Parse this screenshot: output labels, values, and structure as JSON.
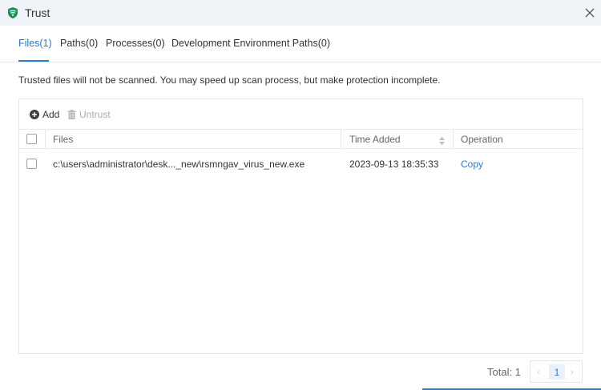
{
  "window": {
    "title": "Trust",
    "icon": "shield-icon",
    "close_icon": "close-icon"
  },
  "tabs": [
    {
      "label": "Files(1)",
      "active": true
    },
    {
      "label": "Paths(0)",
      "active": false
    },
    {
      "label": "Processes(0)",
      "active": false
    },
    {
      "label": "Development Environment Paths(0)",
      "active": false
    }
  ],
  "description": "Trusted files will not be scanned. You may speed up scan process, but make protection incomplete.",
  "toolbar": {
    "add_label": "Add",
    "add_icon": "plus-circle-icon",
    "untrust_label": "Untrust",
    "untrust_icon": "trash-icon"
  },
  "table": {
    "columns": [
      "Files",
      "Time Added",
      "Operation"
    ],
    "rows": [
      {
        "file": "c:\\users\\administrator\\desk..._new\\rsmngav_virus_new.exe",
        "time_added": "2023-09-13 18:35:33",
        "operation": "Copy"
      }
    ]
  },
  "pagination": {
    "total_label": "Total: 1",
    "current_page": "1",
    "prev": "‹",
    "next": "›"
  },
  "colors": {
    "accent": "#2b7cd3",
    "titlebar_bg": "#f0f3f8",
    "border": "#e3e6eb"
  }
}
